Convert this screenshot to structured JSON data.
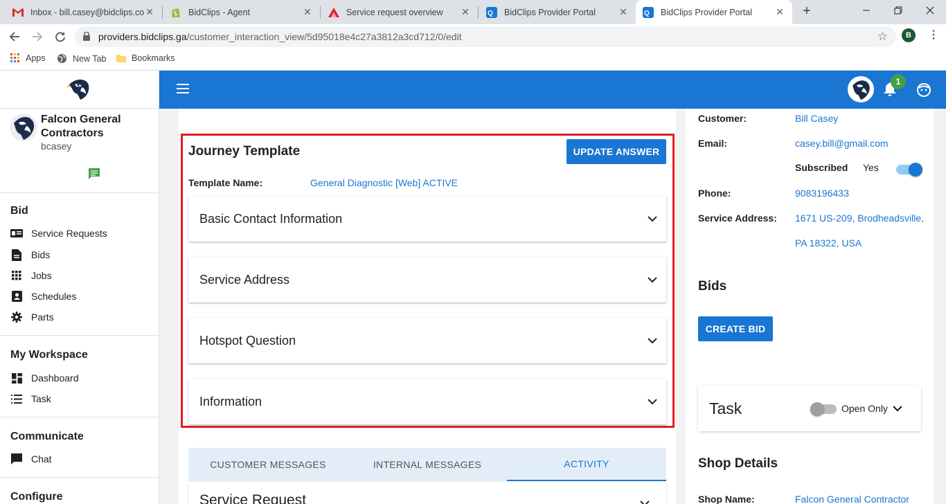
{
  "browser": {
    "tabs": [
      {
        "label": "Inbox - bill.casey@bidclips.com",
        "icon": "gmail-icon"
      },
      {
        "label": "BidClips - Agent",
        "icon": "shopify-icon"
      },
      {
        "label": "Service request overview",
        "icon": "triangle-icon"
      },
      {
        "label": "BidClips Provider Portal",
        "icon": "portal-icon"
      },
      {
        "label": "BidClips Provider Portal",
        "icon": "portal-icon"
      }
    ],
    "url_domain": "providers.bidclips.ga",
    "url_path": "/customer_interaction_view/5d95018e4c27a3812a3cd712/0/edit",
    "profile_initial": "B",
    "bookmarks": [
      "Apps",
      "New Tab",
      "Bookmarks"
    ]
  },
  "sidebar": {
    "company_name": "Falcon General Contractors",
    "username": "bcasey",
    "sections": {
      "bid": {
        "title": "Bid",
        "items": [
          "Service Requests",
          "Bids",
          "Jobs",
          "Schedules",
          "Parts"
        ]
      },
      "workspace": {
        "title": "My Workspace",
        "items": [
          "Dashboard",
          "Task"
        ]
      },
      "communicate": {
        "title": "Communicate",
        "items": [
          "Chat"
        ]
      },
      "configure": {
        "title": "Configure"
      }
    }
  },
  "appbar": {
    "notification_count": "1"
  },
  "journey": {
    "title": "Journey Template",
    "update_button": "UPDATE ANSWER",
    "template_name_label": "Template Name:",
    "template_name_value": "General Diagnostic [Web] ACTIVE",
    "sections": [
      "Basic Contact Information",
      "Service Address",
      "Hotspot Question",
      "Information"
    ]
  },
  "messages": {
    "tabs": [
      "CUSTOMER MESSAGES",
      "INTERNAL MESSAGES",
      "ACTIVITY"
    ],
    "active_tab": "ACTIVITY",
    "next_section": "Service Request"
  },
  "customer": {
    "customer_label": "Customer:",
    "customer_value": "Bill Casey",
    "email_label": "Email:",
    "email_value": "casey.bill@gmail.com",
    "subscribed_label": "Subscribed",
    "subscribed_value": "Yes",
    "subscribed_on": true,
    "phone_label": "Phone:",
    "phone_value": "9083196433",
    "address_label": "Service Address:",
    "address_line1": "1671 US-209, Brodheadsville,",
    "address_line2": "PA 18322, USA"
  },
  "bids": {
    "title": "Bids",
    "create_button": "CREATE BID"
  },
  "task": {
    "title": "Task",
    "toggle_label": "Open Only",
    "toggle_on": false
  },
  "shop": {
    "title": "Shop Details",
    "name_label": "Shop Name:",
    "name_value": "Falcon General Contractor"
  },
  "colors": {
    "primary": "#1976d2",
    "highlight": "#e31b23",
    "badge": "#43a047"
  }
}
